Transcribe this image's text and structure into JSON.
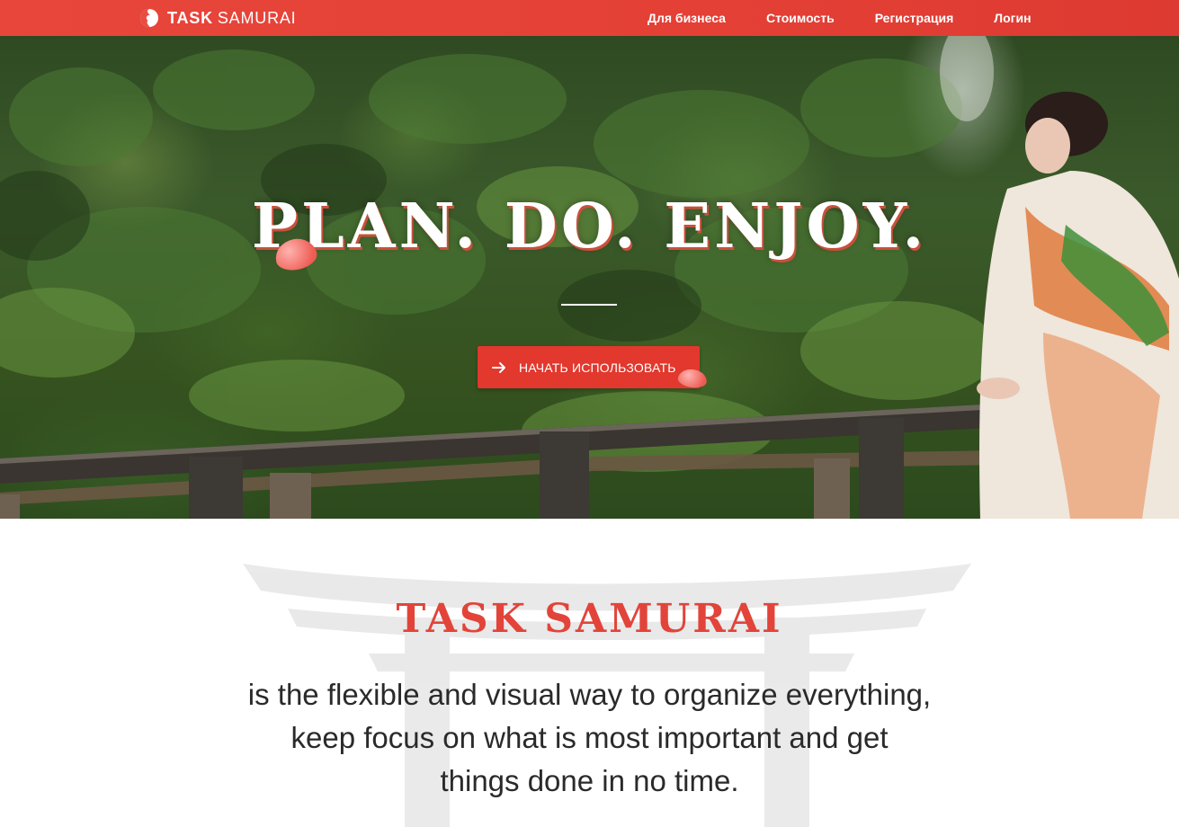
{
  "brand": {
    "bold": "TASK",
    "light": "SAMURAI",
    "color": "#e5453a"
  },
  "nav": [
    {
      "label": "Для бизнеса"
    },
    {
      "label": "Стоимость"
    },
    {
      "label": "Регистрация"
    },
    {
      "label": "Логин"
    }
  ],
  "hero": {
    "headline": "PLAN. DO. ENJOY.",
    "cta_label": "НАЧАТЬ ИСПОЛЬЗОВАТЬ",
    "cta_icon": "arrow-right-icon"
  },
  "about": {
    "title": "TASK SAMURAI",
    "lines": [
      "is the flexible and visual way to organize everything,",
      "keep focus on what is most important and get",
      "things done in no time."
    ]
  },
  "colors": {
    "accent": "#e2382d",
    "text": "#2a2a2a"
  }
}
